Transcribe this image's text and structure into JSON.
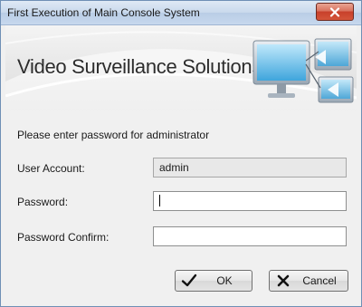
{
  "window": {
    "title": "First Execution of Main Console System"
  },
  "banner": {
    "title": "Video Surveillance Solutions"
  },
  "form": {
    "prompt": "Please enter password for administrator",
    "user_account_label": "User Account:",
    "user_account_value": "admin",
    "password_label": "Password:",
    "password_value": "",
    "password_confirm_label": "Password Confirm:",
    "password_confirm_value": ""
  },
  "buttons": {
    "ok_label": "OK",
    "cancel_label": "Cancel"
  },
  "icons": {
    "close": "close-icon",
    "ok": "checkmark-icon",
    "cancel": "x-icon",
    "banner": "monitor-network-icon"
  },
  "colors": {
    "close_button": "#c7402b",
    "titlebar": "#c9d9ec"
  }
}
